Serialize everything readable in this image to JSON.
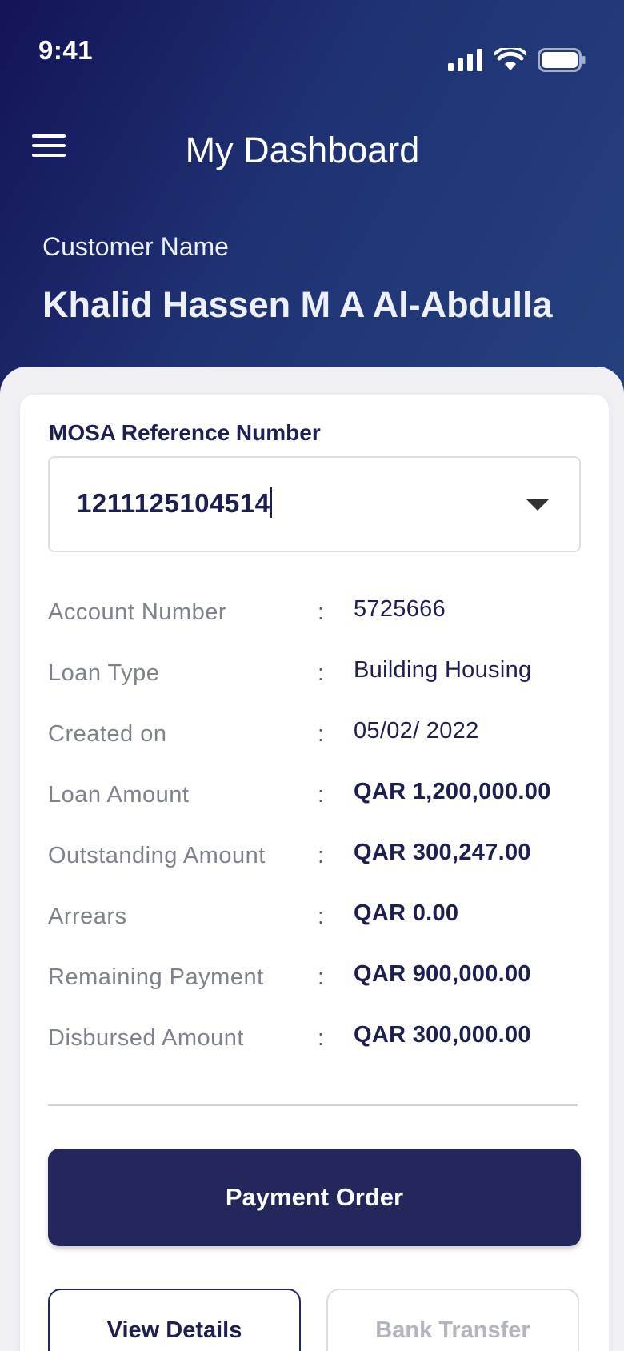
{
  "status_bar": {
    "time": "9:41",
    "icons": [
      "cellular-signal-icon",
      "wifi-icon",
      "battery-icon"
    ]
  },
  "header": {
    "menu_icon": "hamburger-menu-icon",
    "title": "My Dashboard",
    "customer_label": "Customer Name",
    "customer_name": "Khalid Hassen M A Al-Abdulla"
  },
  "reference": {
    "label": "MOSA Reference Number",
    "selected_value": "1211125104514",
    "dropdown_icon": "chevron-down-icon"
  },
  "details": [
    {
      "key": "Account Number",
      "colon": ":",
      "value": "5725666",
      "bold": false
    },
    {
      "key": "Loan Type",
      "colon": ":",
      "value": "Building Housing",
      "bold": false
    },
    {
      "key": "Created on",
      "colon": ":",
      "value": "05/02/ 2022",
      "bold": false
    },
    {
      "key": "Loan Amount",
      "colon": ":",
      "value": "QAR 1,200,000.00",
      "bold": true
    },
    {
      "key": "Outstanding Amount",
      "colon": ":",
      "value": "QAR 300,247.00",
      "bold": true
    },
    {
      "key": "Arrears",
      "colon": ":",
      "value": "QAR 0.00",
      "bold": true
    },
    {
      "key": "Remaining Payment",
      "colon": ":",
      "value": "QAR 900,000.00",
      "bold": true
    },
    {
      "key": "Disbursed Amount",
      "colon": ":",
      "value": "QAR 300,000.00",
      "bold": true
    }
  ],
  "actions": {
    "payment_order": "Payment Order",
    "view_details": "View Details",
    "bank_transfer": "Bank Transfer"
  },
  "colors": {
    "header_dark": "#141358",
    "header_light": "#26417f",
    "primary_button": "#23275c",
    "text_dark": "#1c1f4f",
    "text_muted": "#7d828c",
    "disabled": "#b3b6be"
  }
}
